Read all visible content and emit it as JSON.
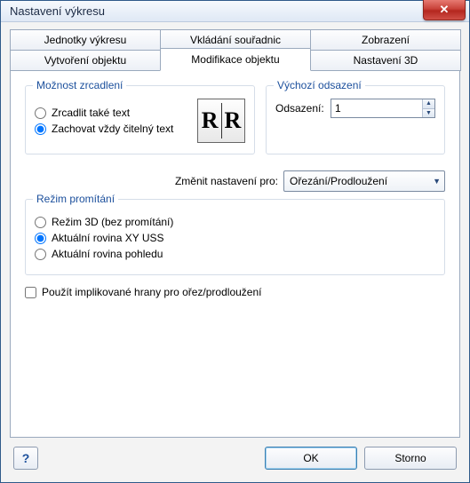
{
  "window": {
    "title": "Nastavení výkresu"
  },
  "tabs": {
    "row1": [
      "Jednotky výkresu",
      "Vkládání souřadnic",
      "Zobrazení"
    ],
    "row2": [
      "Vytvoření objektu",
      "Modifikace objektu",
      "Nastavení 3D"
    ],
    "active": "Modifikace objektu"
  },
  "mirror": {
    "legend": "Možnost zrcadlení",
    "opt_mirror_text": "Zrcadlit také text",
    "opt_keep_readable": "Zachovat vždy čitelný text",
    "r_left": "R",
    "r_right": "R"
  },
  "offset": {
    "legend": "Výchozí odsazení",
    "label": "Odsazení:",
    "value": "1"
  },
  "change_for": {
    "label": "Změnit nastavení pro:",
    "value": "Ořezání/Prodloužení"
  },
  "projection": {
    "legend": "Režim promítání",
    "opt_3d": "Režim 3D (bez promítání)",
    "opt_xy": "Aktuální rovina XY USS",
    "opt_view": "Aktuální rovina pohledu"
  },
  "implied_edges": {
    "label": "Použít implikované hrany pro ořez/prodloužení"
  },
  "buttons": {
    "help": "?",
    "ok": "OK",
    "cancel": "Storno"
  }
}
